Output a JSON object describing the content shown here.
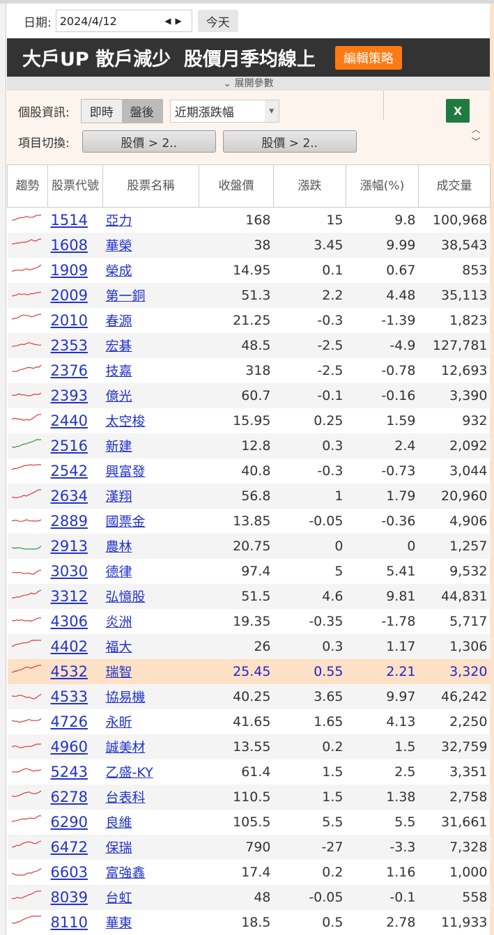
{
  "date_label": "日期:",
  "date_value": "2024/4/12",
  "today_button": "今天",
  "strategy_title": "大戶UP 散戶減少  股價月季均線上",
  "edit_strategy_button": "編輯策略",
  "expand_params": "展開參數",
  "stock_info_label": "個股資訊:",
  "mode_realtime": "即時",
  "mode_after": "盤後",
  "period_select": "近期漲跌幅",
  "excel_icon_text": "X",
  "item_switch_label": "項目切換:",
  "item_buttons": [
    "股價 > 2..",
    "股價 > 2.."
  ],
  "colors": {
    "up": "#e03a3a",
    "down": "#2a9a3a",
    "accent": "#ff7a12",
    "title_bg": "#333333"
  },
  "columns": [
    "趨勢",
    "股票代號",
    "股票名稱",
    "收盤價",
    "漲跌",
    "漲幅(%)",
    "成交量"
  ],
  "rows": [
    {
      "code": "1514",
      "name": "亞力",
      "close": "168",
      "chg": "15",
      "pct": "9.8",
      "vol": "100,968",
      "trend": "up"
    },
    {
      "code": "1608",
      "name": "華榮",
      "close": "38",
      "chg": "3.45",
      "pct": "9.99",
      "vol": "38,543",
      "trend": "up"
    },
    {
      "code": "1909",
      "name": "榮成",
      "close": "14.95",
      "chg": "0.1",
      "pct": "0.67",
      "vol": "853",
      "trend": "up"
    },
    {
      "code": "2009",
      "name": "第一銅",
      "close": "51.3",
      "chg": "2.2",
      "pct": "4.48",
      "vol": "35,113",
      "trend": "up"
    },
    {
      "code": "2010",
      "name": "春源",
      "close": "21.25",
      "chg": "-0.3",
      "pct": "-1.39",
      "vol": "1,823",
      "trend": "up"
    },
    {
      "code": "2353",
      "name": "宏碁",
      "close": "48.5",
      "chg": "-2.5",
      "pct": "-4.9",
      "vol": "127,781",
      "trend": "up"
    },
    {
      "code": "2376",
      "name": "技嘉",
      "close": "318",
      "chg": "-2.5",
      "pct": "-0.78",
      "vol": "12,693",
      "trend": "up"
    },
    {
      "code": "2393",
      "name": "億光",
      "close": "60.7",
      "chg": "-0.1",
      "pct": "-0.16",
      "vol": "3,390",
      "trend": "up"
    },
    {
      "code": "2440",
      "name": "太空梭",
      "close": "15.95",
      "chg": "0.25",
      "pct": "1.59",
      "vol": "932",
      "trend": "up"
    },
    {
      "code": "2516",
      "name": "新建",
      "close": "12.8",
      "chg": "0.3",
      "pct": "2.4",
      "vol": "2,092",
      "trend": "down"
    },
    {
      "code": "2542",
      "name": "興富發",
      "close": "40.8",
      "chg": "-0.3",
      "pct": "-0.73",
      "vol": "3,044",
      "trend": "up"
    },
    {
      "code": "2634",
      "name": "漢翔",
      "close": "56.8",
      "chg": "1",
      "pct": "1.79",
      "vol": "20,960",
      "trend": "up"
    },
    {
      "code": "2889",
      "name": "國票金",
      "close": "13.85",
      "chg": "-0.05",
      "pct": "-0.36",
      "vol": "4,906",
      "trend": "up"
    },
    {
      "code": "2913",
      "name": "農林",
      "close": "20.75",
      "chg": "0",
      "pct": "0",
      "vol": "1,257",
      "trend": "down"
    },
    {
      "code": "3030",
      "name": "德律",
      "close": "97.4",
      "chg": "5",
      "pct": "5.41",
      "vol": "9,532",
      "trend": "up"
    },
    {
      "code": "3312",
      "name": "弘憶股",
      "close": "51.5",
      "chg": "4.6",
      "pct": "9.81",
      "vol": "44,831",
      "trend": "up"
    },
    {
      "code": "4306",
      "name": "炎洲",
      "close": "19.35",
      "chg": "-0.35",
      "pct": "-1.78",
      "vol": "5,717",
      "trend": "up"
    },
    {
      "code": "4402",
      "name": "福大",
      "close": "26",
      "chg": "0.3",
      "pct": "1.17",
      "vol": "1,306",
      "trend": "up"
    },
    {
      "code": "4532",
      "name": "瑞智",
      "close": "25.45",
      "chg": "0.55",
      "pct": "2.21",
      "vol": "3,320",
      "trend": "up",
      "highlight": true
    },
    {
      "code": "4533",
      "name": "協易機",
      "close": "40.25",
      "chg": "3.65",
      "pct": "9.97",
      "vol": "46,242",
      "trend": "up"
    },
    {
      "code": "4726",
      "name": "永昕",
      "close": "41.65",
      "chg": "1.65",
      "pct": "4.13",
      "vol": "2,250",
      "trend": "up"
    },
    {
      "code": "4960",
      "name": "誠美材",
      "close": "13.55",
      "chg": "0.2",
      "pct": "1.5",
      "vol": "32,759",
      "trend": "up"
    },
    {
      "code": "5243",
      "name": "乙盛-KY",
      "close": "61.4",
      "chg": "1.5",
      "pct": "2.5",
      "vol": "3,351",
      "trend": "up"
    },
    {
      "code": "6278",
      "name": "台表科",
      "close": "110.5",
      "chg": "1.5",
      "pct": "1.38",
      "vol": "2,758",
      "trend": "up"
    },
    {
      "code": "6290",
      "name": "良維",
      "close": "105.5",
      "chg": "5.5",
      "pct": "5.5",
      "vol": "31,661",
      "trend": "up"
    },
    {
      "code": "6472",
      "name": "保瑞",
      "close": "790",
      "chg": "-27",
      "pct": "-3.3",
      "vol": "7,328",
      "trend": "up"
    },
    {
      "code": "6603",
      "name": "富強鑫",
      "close": "17.4",
      "chg": "0.2",
      "pct": "1.16",
      "vol": "1,000",
      "trend": "up"
    },
    {
      "code": "8039",
      "name": "台虹",
      "close": "48",
      "chg": "-0.05",
      "pct": "-0.1",
      "vol": "558",
      "trend": "up"
    },
    {
      "code": "8110",
      "name": "華東",
      "close": "18.5",
      "chg": "0.5",
      "pct": "2.78",
      "vol": "11,933",
      "trend": "up"
    }
  ]
}
